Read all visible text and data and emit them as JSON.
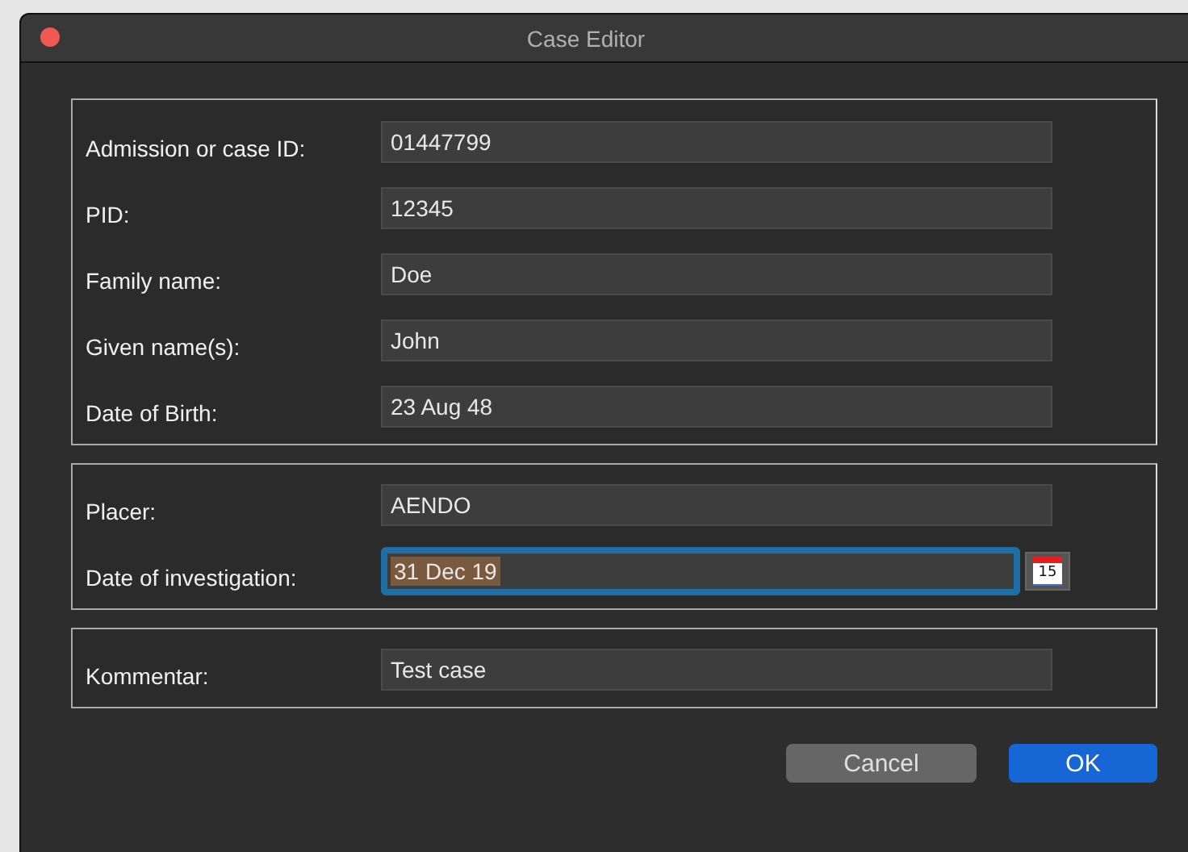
{
  "window": {
    "title": "Case Editor",
    "close_button": true
  },
  "groups": [
    {
      "fields": [
        {
          "label": "Admission or case ID:",
          "value": "01447799",
          "focused": false
        },
        {
          "label": "PID:",
          "value": "12345",
          "focused": false
        },
        {
          "label": "Family name:",
          "value": "Doe",
          "focused": false
        },
        {
          "label": "Given name(s):",
          "value": "John",
          "focused": false
        },
        {
          "label": "Date of Birth:",
          "value": "23 Aug 48",
          "focused": false
        }
      ]
    },
    {
      "fields": [
        {
          "label": "Placer:",
          "value": "AENDO",
          "focused": false
        },
        {
          "label": "Date of investigation:",
          "value": "31 Dec 19",
          "focused": true,
          "calendar_day": "15"
        }
      ]
    },
    {
      "fields": [
        {
          "label": "Kommentar:",
          "value": "Test case",
          "focused": false
        }
      ]
    }
  ],
  "buttons": [
    {
      "label": "Cancel",
      "kind": "secondary"
    },
    {
      "label": "OK",
      "kind": "primary"
    }
  ]
}
